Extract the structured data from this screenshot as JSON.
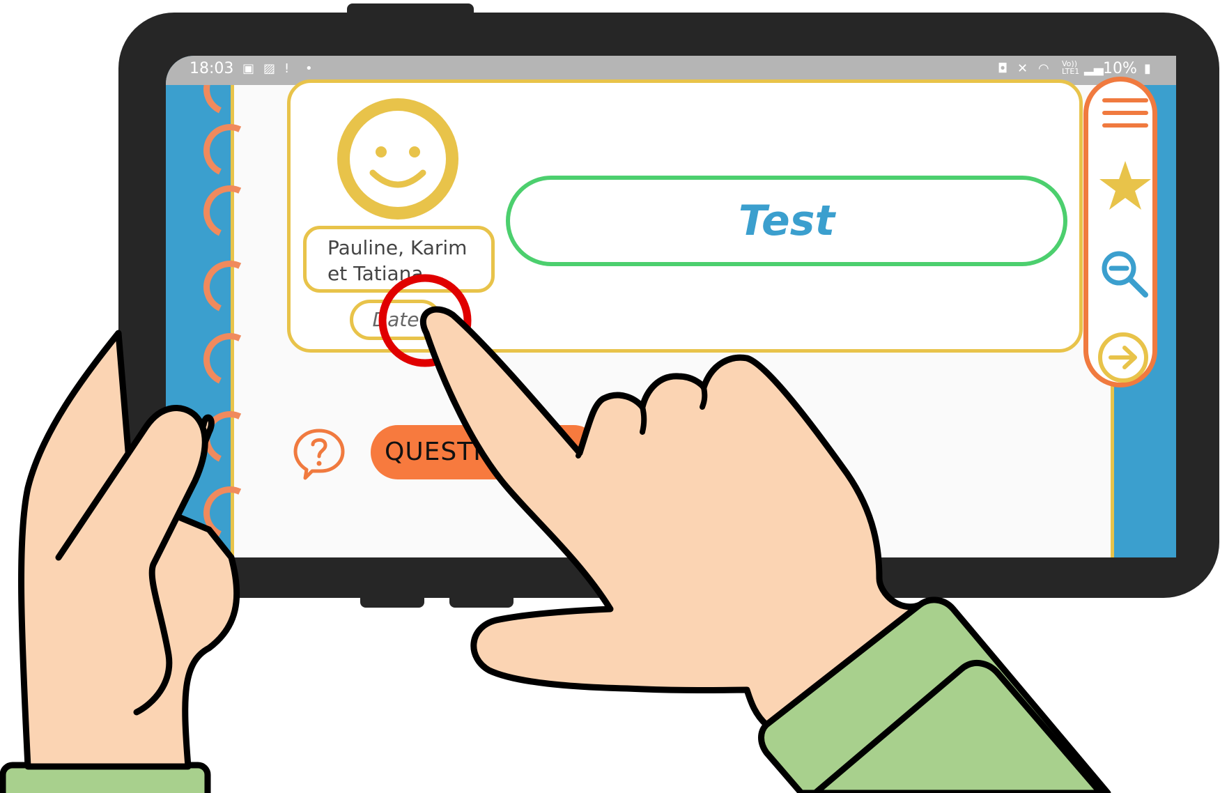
{
  "status_bar": {
    "time": "18:03",
    "battery": "10%",
    "icons": [
      "notification-icon",
      "image-icon",
      "alert-icon",
      "dot-icon",
      "battery-saver-icon",
      "mute-icon",
      "wifi-icon",
      "volte-icon",
      "signal-icon",
      "battery-icon"
    ],
    "volte_label": "Vo)) LTE1"
  },
  "profile": {
    "avatar_icon": "smiley-icon",
    "names_line1": "Pauline, Karim",
    "names_line2": "et Tatiana",
    "date_placeholder": "Date"
  },
  "title": "Test",
  "side_menu": {
    "items": [
      "menu-icon",
      "star-icon",
      "zoom-out-icon",
      "next-arrow-icon"
    ]
  },
  "question": {
    "icon": "question-bubble-icon",
    "label": "QUESTIO"
  },
  "colors": {
    "blue": "#3b9fce",
    "yellow": "#e8c34a",
    "orange": "#f07a3f",
    "green": "#4ccf6e",
    "tablet": "#262626",
    "skin": "#fbd4b3",
    "sleeve": "#a8d08d",
    "tap_ring": "#e00000"
  }
}
